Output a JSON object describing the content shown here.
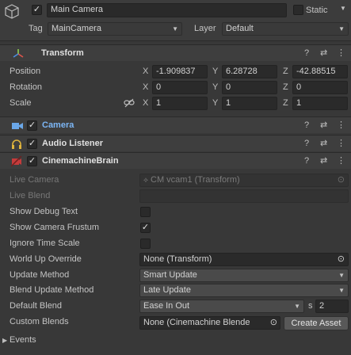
{
  "gameobject": {
    "name": "Main Camera",
    "static_label": "Static",
    "tag_label": "Tag",
    "tag_value": "MainCamera",
    "layer_label": "Layer",
    "layer_value": "Default"
  },
  "transform": {
    "title": "Transform",
    "position_label": "Position",
    "rotation_label": "Rotation",
    "scale_label": "Scale",
    "axis_x": "X",
    "axis_y": "Y",
    "axis_z": "Z",
    "position": {
      "x": "-1.909837",
      "y": "6.28728",
      "z": "-42.88515"
    },
    "rotation": {
      "x": "0",
      "y": "0",
      "z": "0"
    },
    "scale": {
      "x": "1",
      "y": "1",
      "z": "1"
    }
  },
  "components": {
    "camera": "Camera",
    "audio_listener": "Audio Listener",
    "cinemachine_brain": "CinemachineBrain"
  },
  "brain": {
    "live_camera_label": "Live Camera",
    "live_camera_value": "CM vcam1 (Transform)",
    "live_blend_label": "Live Blend",
    "show_debug_text_label": "Show Debug Text",
    "show_camera_frustum_label": "Show Camera Frustum",
    "ignore_time_scale_label": "Ignore Time Scale",
    "world_up_override_label": "World Up Override",
    "world_up_override_value": "None (Transform)",
    "update_method_label": "Update Method",
    "update_method_value": "Smart Update",
    "blend_update_method_label": "Blend Update Method",
    "blend_update_method_value": "Late Update",
    "default_blend_label": "Default Blend",
    "default_blend_value": "Ease In Out",
    "default_blend_s": "s",
    "default_blend_time": "2",
    "custom_blends_label": "Custom Blends",
    "custom_blends_value": "None (Cinemachine Blende",
    "create_asset_label": "Create Asset",
    "events_label": "Events"
  },
  "icons": {
    "help": "?",
    "settings": "⇄",
    "more": "⋮",
    "check": "✓",
    "target": "⊙"
  }
}
